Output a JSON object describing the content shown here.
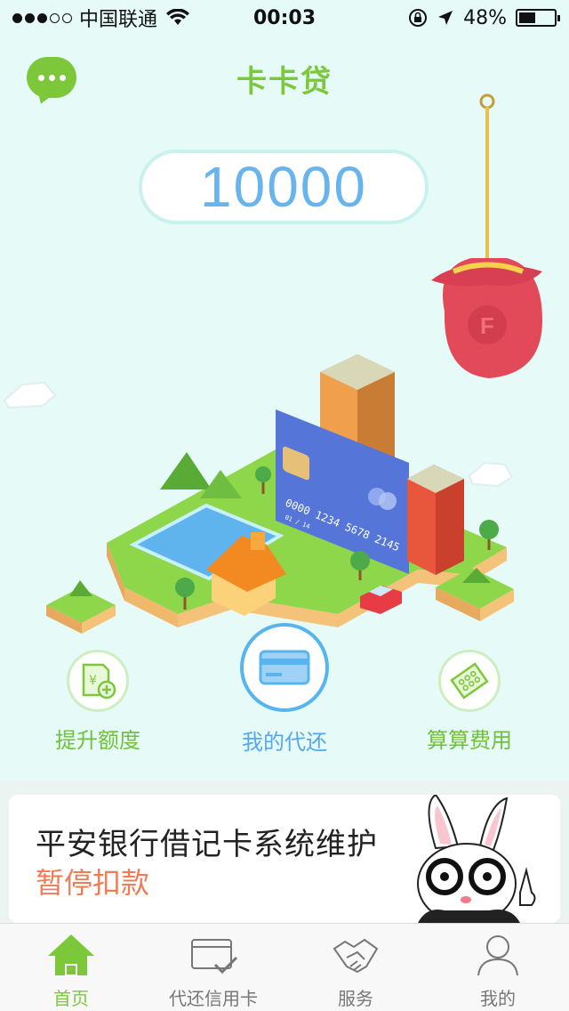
{
  "status_bar": {
    "carrier": "中国联通",
    "time": "00:03",
    "battery": "48%",
    "battery_level": 0.48
  },
  "header": {
    "title": "卡卡贷"
  },
  "amount": "10000",
  "card_text": {
    "number": "0000 1234 5678 2145",
    "expiry": "01 / 14"
  },
  "actions": [
    {
      "label": "提升额度",
      "icon": "receipt-add-icon"
    },
    {
      "label": "我的代还",
      "icon": "credit-card-icon"
    },
    {
      "label": "算算费用",
      "icon": "fee-ticket-icon"
    }
  ],
  "notice": {
    "title": "平安银行借记卡系统维护",
    "subtitle": "暂停扣款"
  },
  "tabs": [
    {
      "label": "首页",
      "icon": "home-icon",
      "active": true
    },
    {
      "label": "代还信用卡",
      "icon": "card-check-icon",
      "active": false
    },
    {
      "label": "服务",
      "icon": "handshake-icon",
      "active": false
    },
    {
      "label": "我的",
      "icon": "user-icon",
      "active": false
    }
  ],
  "colors": {
    "brand_green": "#7cc83a",
    "accent_blue": "#56b4ef",
    "notice_orange": "#f07c55"
  }
}
